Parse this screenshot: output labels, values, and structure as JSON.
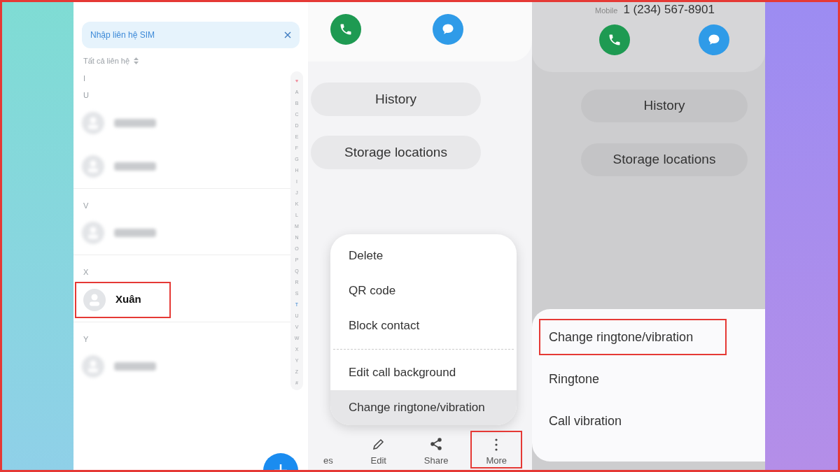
{
  "contacts_screen": {
    "sim_banner": {
      "text": "Nhập liên hệ SIM"
    },
    "filter": "Tất cả liên hệ",
    "sections": [
      {
        "letter": "I"
      },
      {
        "letter": "U",
        "contacts": [
          {
            "kind": "blurred",
            "highlighted": false
          },
          {
            "kind": "blurred",
            "highlighted": false
          }
        ]
      },
      {
        "letter": "V",
        "contacts": [
          {
            "kind": "blurred",
            "highlighted": false
          }
        ]
      },
      {
        "letter": "X",
        "contacts": [
          {
            "kind": "named",
            "name": "Xuân",
            "highlighted": true
          }
        ]
      },
      {
        "letter": "Y",
        "contacts": [
          {
            "kind": "blurred",
            "highlighted": false
          }
        ]
      }
    ],
    "index": [
      {
        "label": "♥",
        "selected": false
      },
      {
        "label": "A",
        "selected": false
      },
      {
        "label": "B",
        "selected": false
      },
      {
        "label": "C",
        "selected": false
      },
      {
        "label": "D",
        "selected": false
      },
      {
        "label": "E",
        "selected": false
      },
      {
        "label": "F",
        "selected": false
      },
      {
        "label": "G",
        "selected": false
      },
      {
        "label": "H",
        "selected": false
      },
      {
        "label": "I",
        "selected": false
      },
      {
        "label": "J",
        "selected": false
      },
      {
        "label": "K",
        "selected": false
      },
      {
        "label": "L",
        "selected": false
      },
      {
        "label": "M",
        "selected": false
      },
      {
        "label": "N",
        "selected": false
      },
      {
        "label": "O",
        "selected": false
      },
      {
        "label": "P",
        "selected": false
      },
      {
        "label": "Q",
        "selected": false
      },
      {
        "label": "R",
        "selected": false
      },
      {
        "label": "S",
        "selected": false
      },
      {
        "label": "T",
        "selected": true
      },
      {
        "label": "U",
        "selected": false
      },
      {
        "label": "V",
        "selected": false
      },
      {
        "label": "W",
        "selected": false
      },
      {
        "label": "X",
        "selected": false
      },
      {
        "label": "Y",
        "selected": false
      },
      {
        "label": "Z",
        "selected": false
      },
      {
        "label": "#",
        "selected": false
      }
    ]
  },
  "contact_screen": {
    "buttons": [
      "History",
      "Storage locations"
    ],
    "menu": [
      {
        "label": "Delete",
        "selected": false,
        "divider_after": false
      },
      {
        "label": "QR code",
        "selected": false,
        "divider_after": false
      },
      {
        "label": "Block contact",
        "selected": false,
        "divider_after": true
      },
      {
        "label": "Edit call background",
        "selected": false,
        "divider_after": false
      },
      {
        "label": "Change ringtone/vibration",
        "selected": true,
        "divider_after": false
      }
    ],
    "nav": [
      {
        "kind": "text",
        "label": "es",
        "highlighted": false
      },
      {
        "kind": "edit",
        "label": "Edit",
        "highlighted": false
      },
      {
        "kind": "share",
        "label": "Share",
        "highlighted": false
      },
      {
        "kind": "more",
        "label": "More",
        "highlighted": true
      }
    ]
  },
  "ringtone_screen": {
    "phone_label": "Mobile",
    "phone": "1 (234) 567-8901",
    "buttons": [
      "History",
      "Storage locations"
    ],
    "sheet": [
      {
        "label": "Change ringtone/vibration",
        "highlighted": true
      },
      {
        "label": "Ringtone",
        "highlighted": false
      },
      {
        "label": "Call vibration",
        "highlighted": false
      }
    ]
  }
}
